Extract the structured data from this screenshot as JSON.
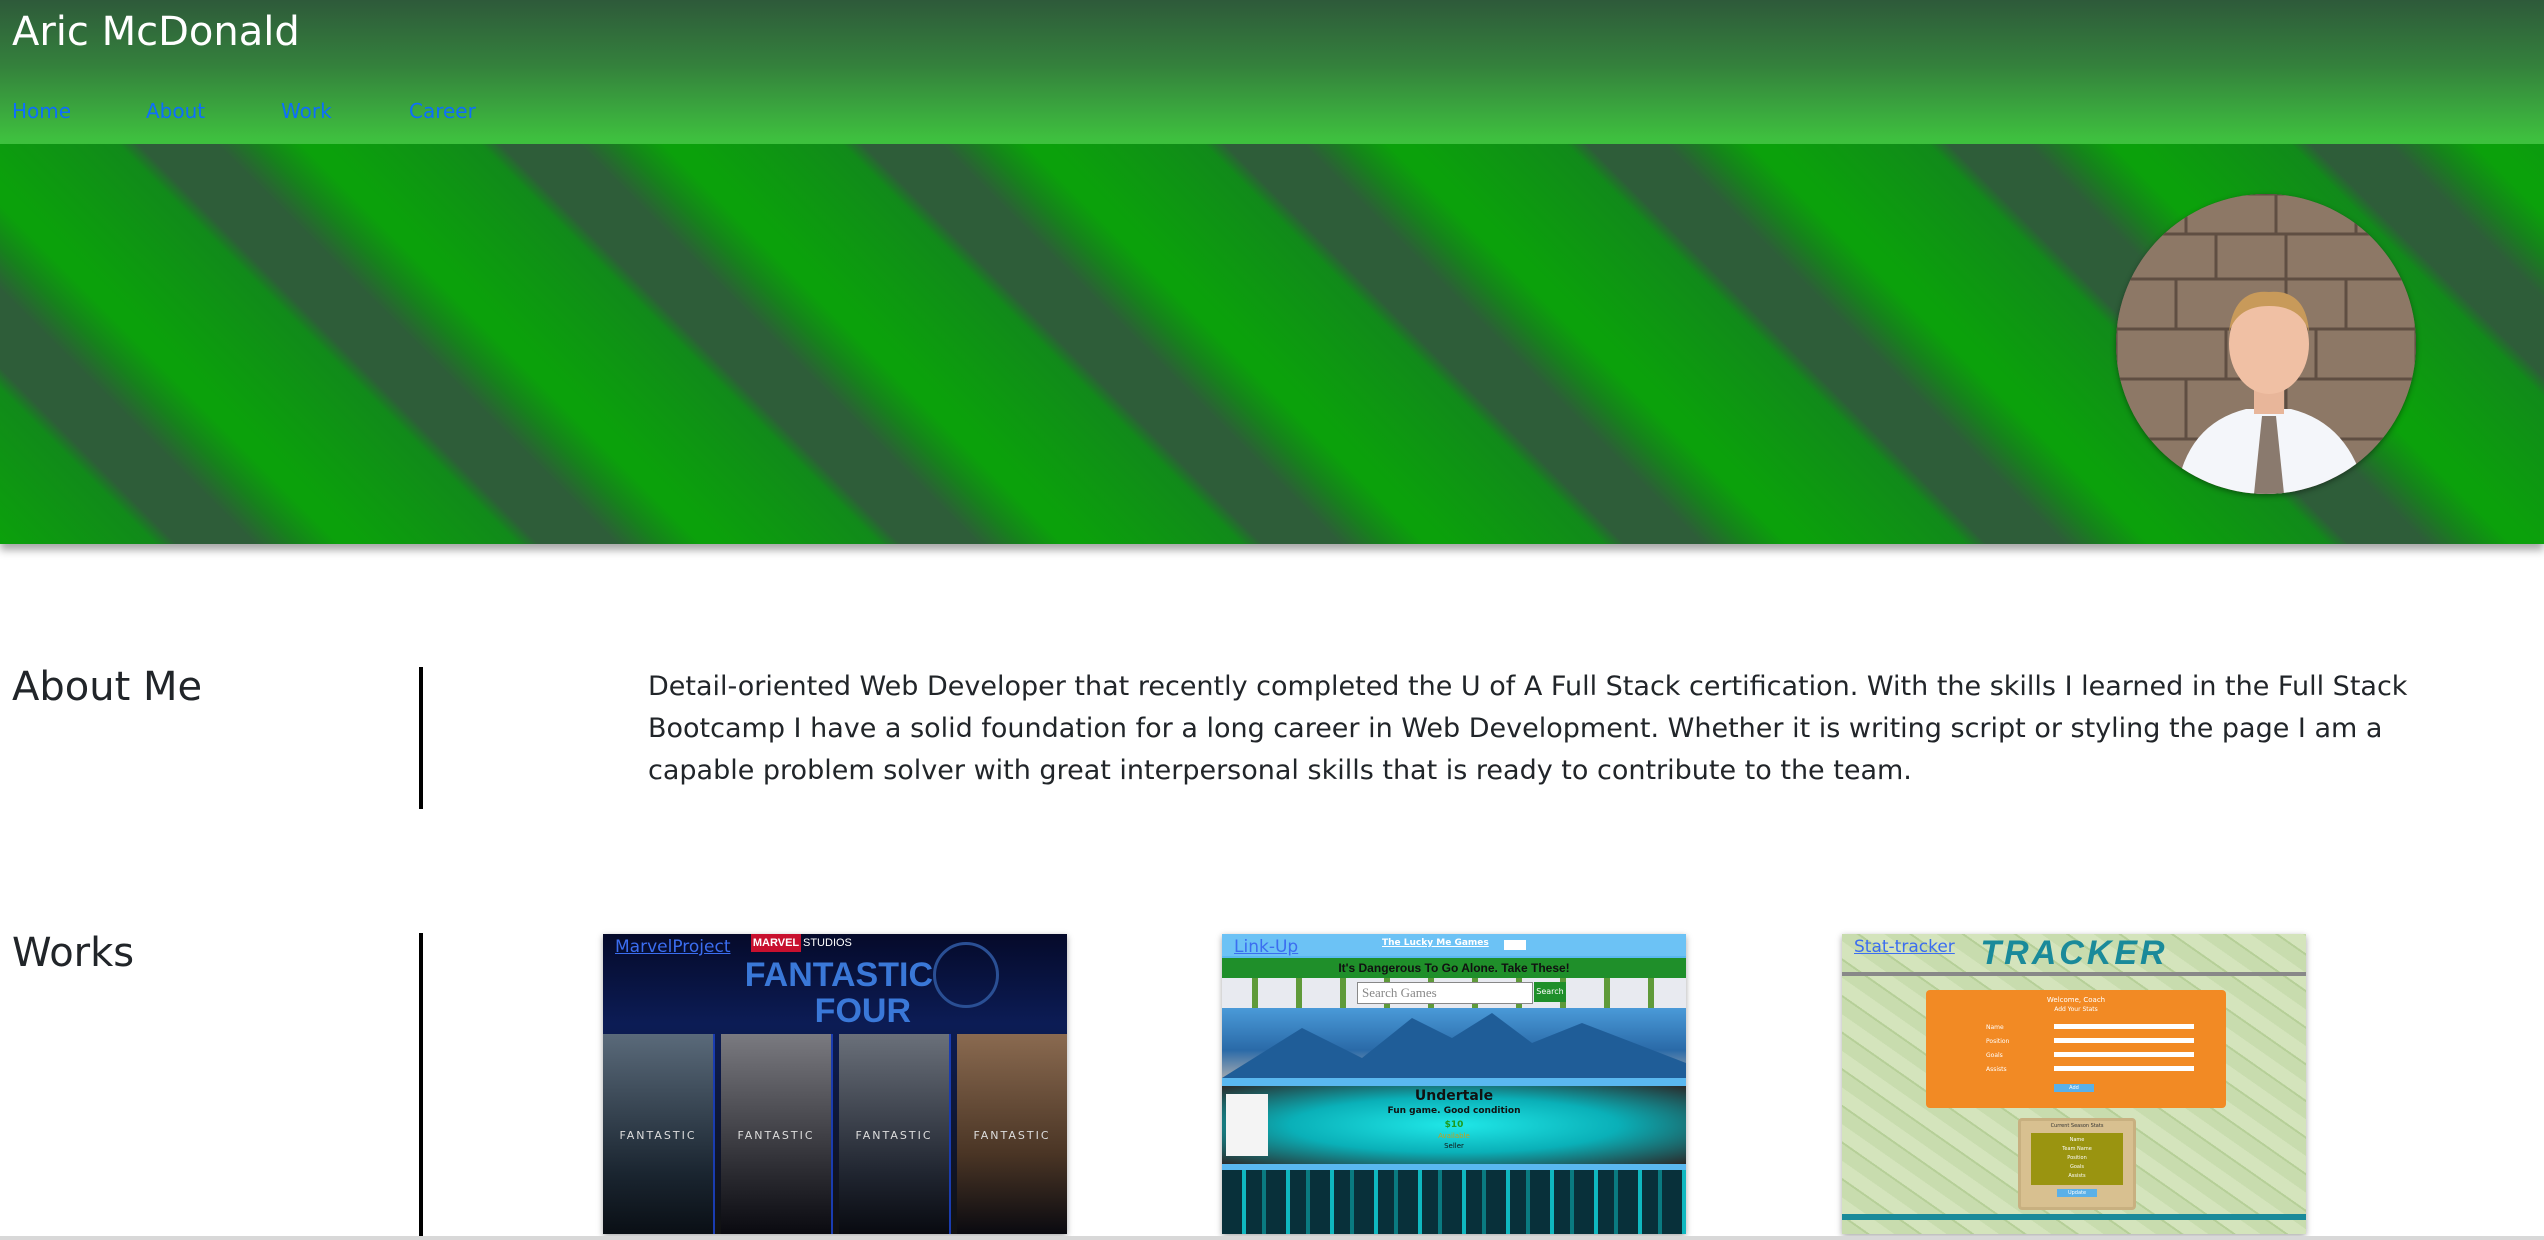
{
  "header": {
    "site_title": "Aric McDonald",
    "nav": [
      "Home",
      "About",
      "Work",
      "Career"
    ]
  },
  "hero": {
    "avatar_icon": "profile-photo"
  },
  "about": {
    "title": "About Me",
    "text": "Detail-oriented Web Developer that recently completed the U of A Full Stack certification. With the skills I learned in the Full Stack Bootcamp I have a solid foundation for a long career in Web Development. Whether it is writing script or styling the page I am a capable problem solver with great interpersonal skills that is ready to contribute to the team."
  },
  "works": {
    "title": "Works",
    "projects": [
      {
        "label": "MarvelProject",
        "screenshot": {
          "studio_logo": "MARVEL",
          "studio_word": "STUDIOS",
          "title_line1": "FANTASTIC",
          "title_line2": "FOUR",
          "poster_text": "FANTASTIC"
        }
      },
      {
        "label": "Link-Up",
        "screenshot": {
          "top_title": "The Lucky Me Games",
          "banner": "It's Dangerous To Go Alone. Take These!",
          "search_placeholder": "Search Games",
          "search_button": "Search",
          "item_title": "Undertale",
          "item_subtitle": "Fun game. Good condition",
          "item_price": "$10",
          "item_status": "Available",
          "item_seller": "Seller"
        }
      },
      {
        "label": "Stat-tracker",
        "screenshot": {
          "logo": "TRACKER",
          "welcome": "Welcome, Coach",
          "form_title": "Add Your Stats",
          "fields": [
            "Name",
            "Position",
            "Goals",
            "Assists"
          ],
          "submit": "Add",
          "card_title": "Current Season Stats",
          "card_lines": [
            "Name",
            "Team Name",
            "Position",
            "Goals",
            "Assists"
          ],
          "card_button": "Update"
        }
      }
    ]
  },
  "colors": {
    "header_dark": "#2e5a3a",
    "header_light": "#3fc43f",
    "stripe_green": "#0ba10b",
    "stripe_dark": "#2e5d39",
    "link": "#0d6efd"
  }
}
